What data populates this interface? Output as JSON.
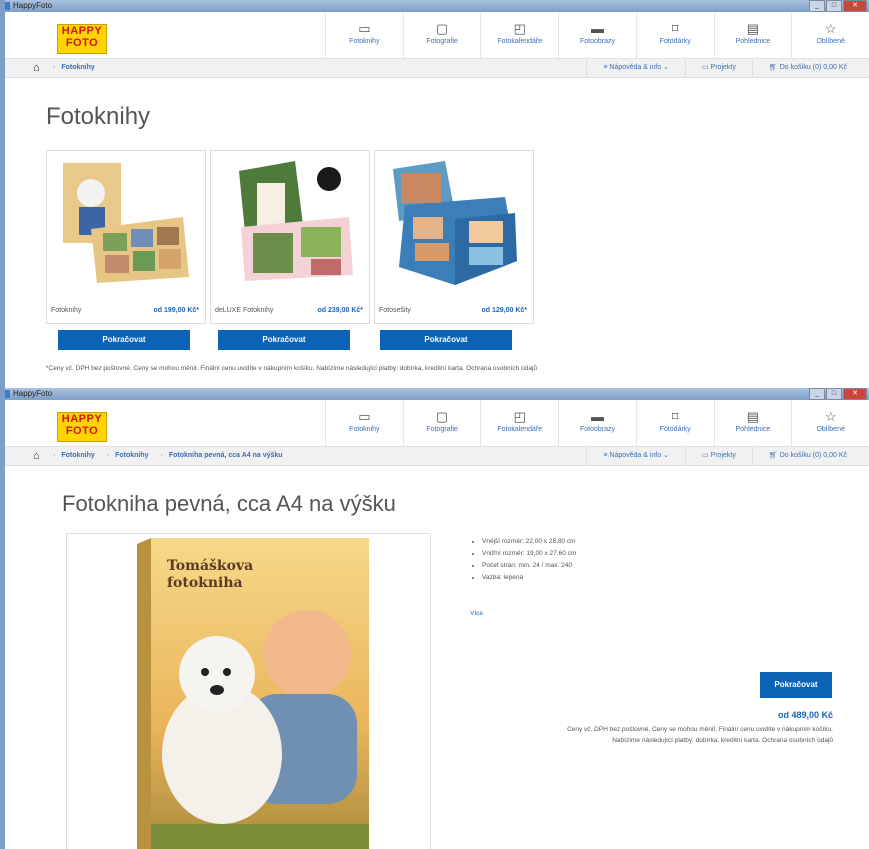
{
  "window": {
    "title": "HappyFoto"
  },
  "logo": {
    "line1": "HAPPY",
    "line2": "FOTO"
  },
  "nav": [
    {
      "label": "Fotoknihy",
      "icon": "book-icon"
    },
    {
      "label": "Fotografie",
      "icon": "photo-icon"
    },
    {
      "label": "Fotokalendáře",
      "icon": "calendar-wall-icon"
    },
    {
      "label": "Fotoobrazy",
      "icon": "canvas-icon"
    },
    {
      "label": "Fotodárky",
      "icon": "gift-icon"
    },
    {
      "label": "Pohlednice",
      "icon": "card-icon"
    },
    {
      "label": "Oblíbené",
      "icon": "star-icon"
    }
  ],
  "toolbar": {
    "help": "Nápověda & info",
    "projects": "Projekty",
    "cart": "Do košíku (0) 0,00 Kč"
  },
  "screen1": {
    "breadcrumb": [
      "Fotoknihy"
    ],
    "title": "Fotoknihy",
    "products": [
      {
        "name": "Fotoknihy",
        "price": "od 199,00 Kč*",
        "button": "Pokračovat"
      },
      {
        "name": "deLUXE Fotoknihy",
        "price": "od 239,00 Kč*",
        "button": "Pokračovat"
      },
      {
        "name": "Fotosešity",
        "price": "od 129,00 Kč*",
        "button": "Pokračovat"
      }
    ],
    "note": "*Ceny vč. DPH bez poštovné. Ceny se mohou měnit. Finální cenu uvidíte v nákupním košíku. Nabízíme následující platby: dobírka, kreditní karta. Ochrana osobních údajů"
  },
  "screen2": {
    "breadcrumb": [
      "Fotoknihy",
      "Fotoknihy",
      "Fotokniha pevná, cca A4 na výšku"
    ],
    "title": "Fotokniha pevná, cca A4 na výšku",
    "cover_text": "Tomáškova fotokniha",
    "specs": [
      "Vnější rozměr: 22,00 x 28,80 cm",
      "Vnitřní rozměr: 19,00 x 27,60 cm",
      "Počet stran: min. 24 / max. 240",
      "Vazba: lepená"
    ],
    "more": "Více",
    "button": "Pokračovat",
    "price": "od 489,00 Kč",
    "note_line1": "Ceny vč. DPH bez poštovné. Ceny se mohou měnit. Finální cenu uvidíte v nákupním košíku.",
    "note_line2": "Nabízíme následující platby: dobírka, kreditní karta. Ochrana osobních údajů"
  }
}
